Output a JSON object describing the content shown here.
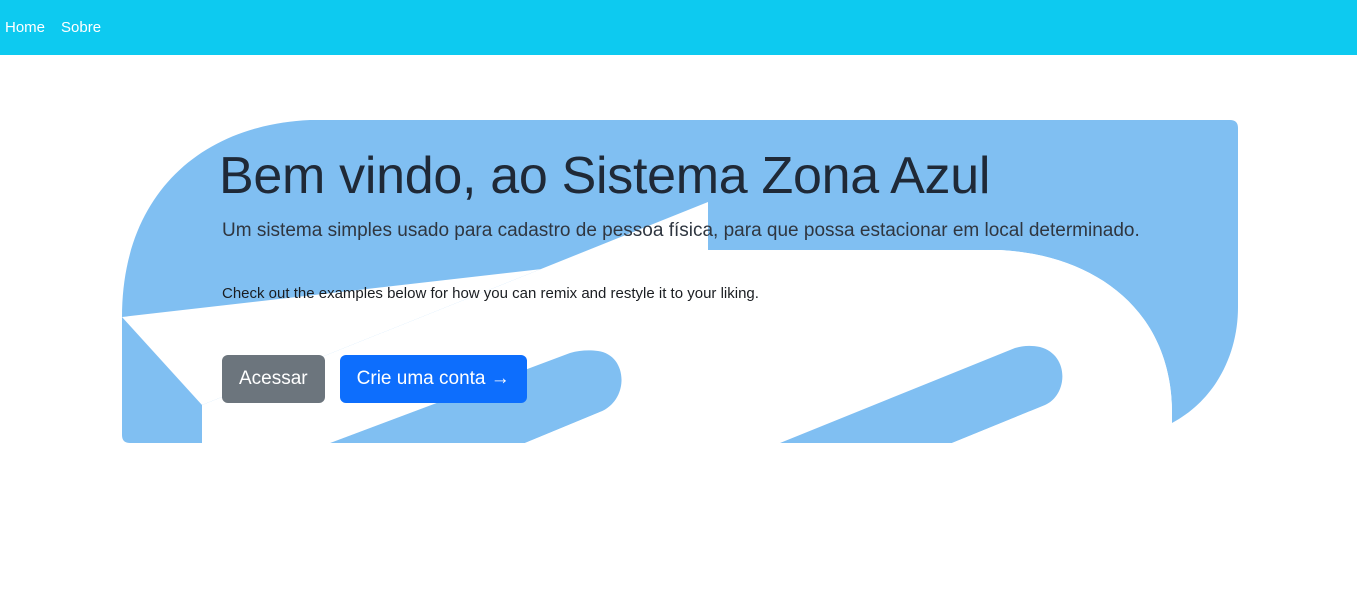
{
  "nav": {
    "items": [
      {
        "label": "Home"
      },
      {
        "label": "Sobre"
      }
    ]
  },
  "hero": {
    "title": "Bem vindo, ao Sistema Zona Azul",
    "lead": "Um sistema simples usado para cadastro de pessoa física, para que possa estacionar em local determinado.",
    "text": "Check out the examples below for how you can remix and restyle it to your liking.",
    "buttons": {
      "login_label": "Acessar",
      "signup_label": "Crie uma conta →"
    }
  },
  "colors": {
    "navbar": "#0dcaf0",
    "hero_shape": "#80bff2",
    "btn_secondary": "#6c757d",
    "btn_primary": "#0d6efd"
  }
}
